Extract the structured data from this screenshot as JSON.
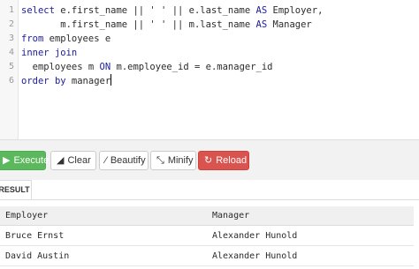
{
  "editor": {
    "line_numbers": [
      "1",
      "2",
      "3",
      "4",
      "5",
      "6"
    ],
    "lines": [
      {
        "pre": "",
        "parts": [
          {
            "t": "select e.first_name || ' ' || e.last_name AS Employer,",
            "k": false
          }
        ]
      },
      {
        "pre": "",
        "parts": [
          {
            "t": "       m.first_name || ' ' || m.last_name AS Manager",
            "k": false
          }
        ]
      },
      {
        "pre": "",
        "parts": [
          {
            "t": "from employees e",
            "k": false
          }
        ]
      },
      {
        "pre": "",
        "parts": [
          {
            "t": "inner join",
            "k": false
          }
        ]
      },
      {
        "pre": "",
        "parts": [
          {
            "t": "  employees m ON m.employee_id = e.manager_id",
            "k": false
          }
        ]
      },
      {
        "pre": "",
        "parts": [
          {
            "t": "order by manager",
            "k": false
          }
        ]
      }
    ]
  },
  "toolbar": {
    "execute_label": "Execute",
    "clear_label": "Clear",
    "beautify_label": "Beautify",
    "minify_label": "Minify",
    "reload_label": "Reload",
    "icons": {
      "execute": "play-icon",
      "clear": "eraser-icon",
      "beautify": "magic-wand-icon",
      "minify": "compress-icon",
      "reload": "reload-icon"
    },
    "colors": {
      "execute": "#5cb85c",
      "reload": "#d9534f"
    }
  },
  "results": {
    "tab_label": "RESULT",
    "columns": [
      "Employer",
      "Manager"
    ],
    "rows": [
      [
        "Bruce Ernst",
        "Alexander Hunold"
      ],
      [
        "David Austin",
        "Alexander Hunold"
      ]
    ]
  }
}
